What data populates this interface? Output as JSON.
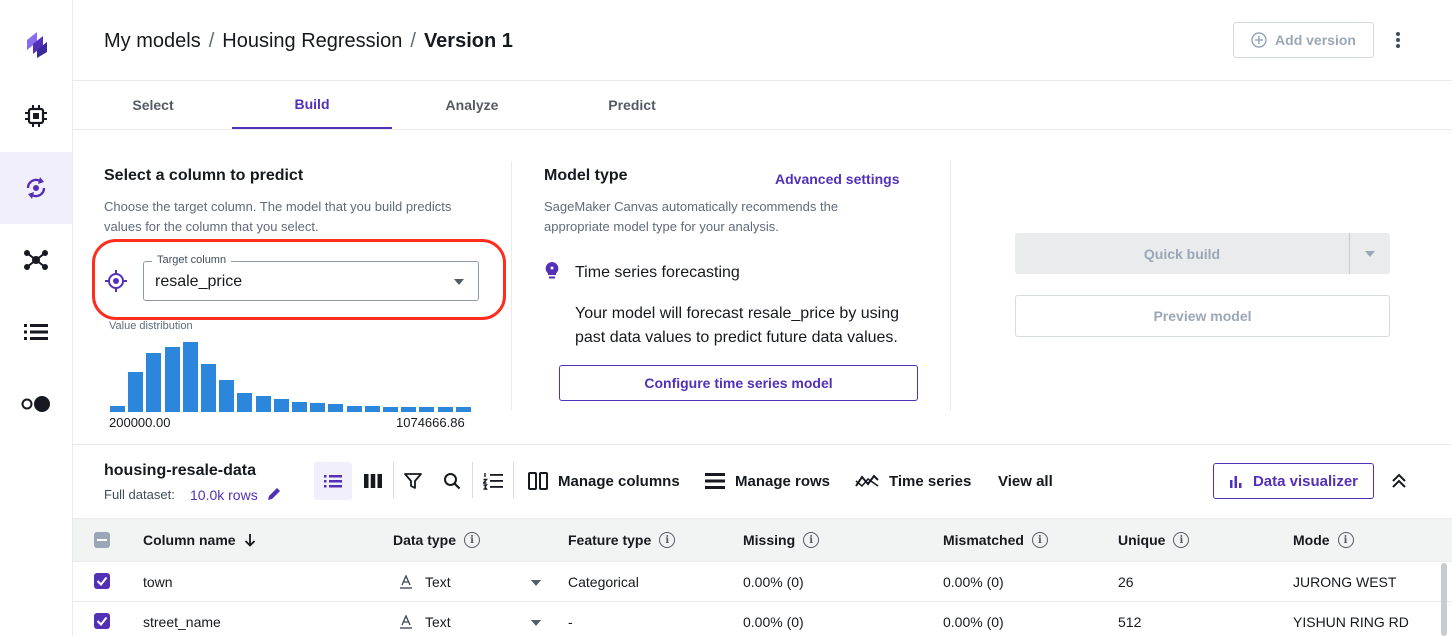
{
  "nav_rail": {
    "items": [
      {
        "icon": "canvas-logo-icon",
        "active": false
      },
      {
        "icon": "chip-icon",
        "active": false
      },
      {
        "icon": "model-cycle-icon",
        "active": true
      },
      {
        "icon": "network-icon",
        "active": false
      },
      {
        "icon": "list-icon",
        "active": false
      },
      {
        "icon": "toggle-icon",
        "active": false
      }
    ]
  },
  "header": {
    "breadcrumb": [
      "My models",
      "Housing Regression",
      "Version 1"
    ],
    "separator": "/",
    "add_version_label": "Add version"
  },
  "tabs": [
    "Select",
    "Build",
    "Analyze",
    "Predict"
  ],
  "active_tab": "Build",
  "target": {
    "title": "Select a column to predict",
    "description": "Choose the target column. The model that you build predicts values for the column that you select.",
    "field_label": "Target column",
    "field_value": "resale_price",
    "dist_label": "Value distribution",
    "dist_min": "200000.00",
    "dist_max": "1074666.86",
    "histogram": [
      0.09,
      0.55,
      0.82,
      0.9,
      0.97,
      0.67,
      0.44,
      0.27,
      0.22,
      0.18,
      0.14,
      0.13,
      0.11,
      0.09,
      0.08,
      0.07,
      0.07,
      0.07,
      0.07,
      0.07
    ]
  },
  "model_type": {
    "title": "Model type",
    "advanced_link": "Advanced settings",
    "description": "SageMaker Canvas automatically recommends the appropriate model type for your analysis.",
    "type_name": "Time series forecasting",
    "type_desc": "Your model will forecast resale_price by using past data values to predict future data values.",
    "configure_button": "Configure time series model"
  },
  "build_actions": {
    "quick_build": "Quick build",
    "preview": "Preview model"
  },
  "dataset": {
    "name": "housing-resale-data",
    "full_dataset_label": "Full dataset:",
    "rows_label": "10.0k rows",
    "actions": [
      "Manage columns",
      "Manage rows",
      "Time series",
      "View all"
    ],
    "visualizer": "Data visualizer"
  },
  "table": {
    "headers": [
      "Column name",
      "Data type",
      "Feature type",
      "Missing",
      "Mismatched",
      "Unique",
      "Mode"
    ],
    "rows": [
      {
        "name": "town",
        "dtype": "Text",
        "ftype": "Categorical",
        "missing": "0.00% (0)",
        "mismatched": "0.00% (0)",
        "unique": "26",
        "mode": "JURONG WEST"
      },
      {
        "name": "street_name",
        "dtype": "Text",
        "ftype": "-",
        "missing": "0.00% (0)",
        "mismatched": "0.00% (0)",
        "unique": "512",
        "mode": "YISHUN RING RD"
      }
    ]
  },
  "colors": {
    "accent": "#5330b7",
    "highlight": "#ff2d1f",
    "histogram": "#2b86dc"
  }
}
